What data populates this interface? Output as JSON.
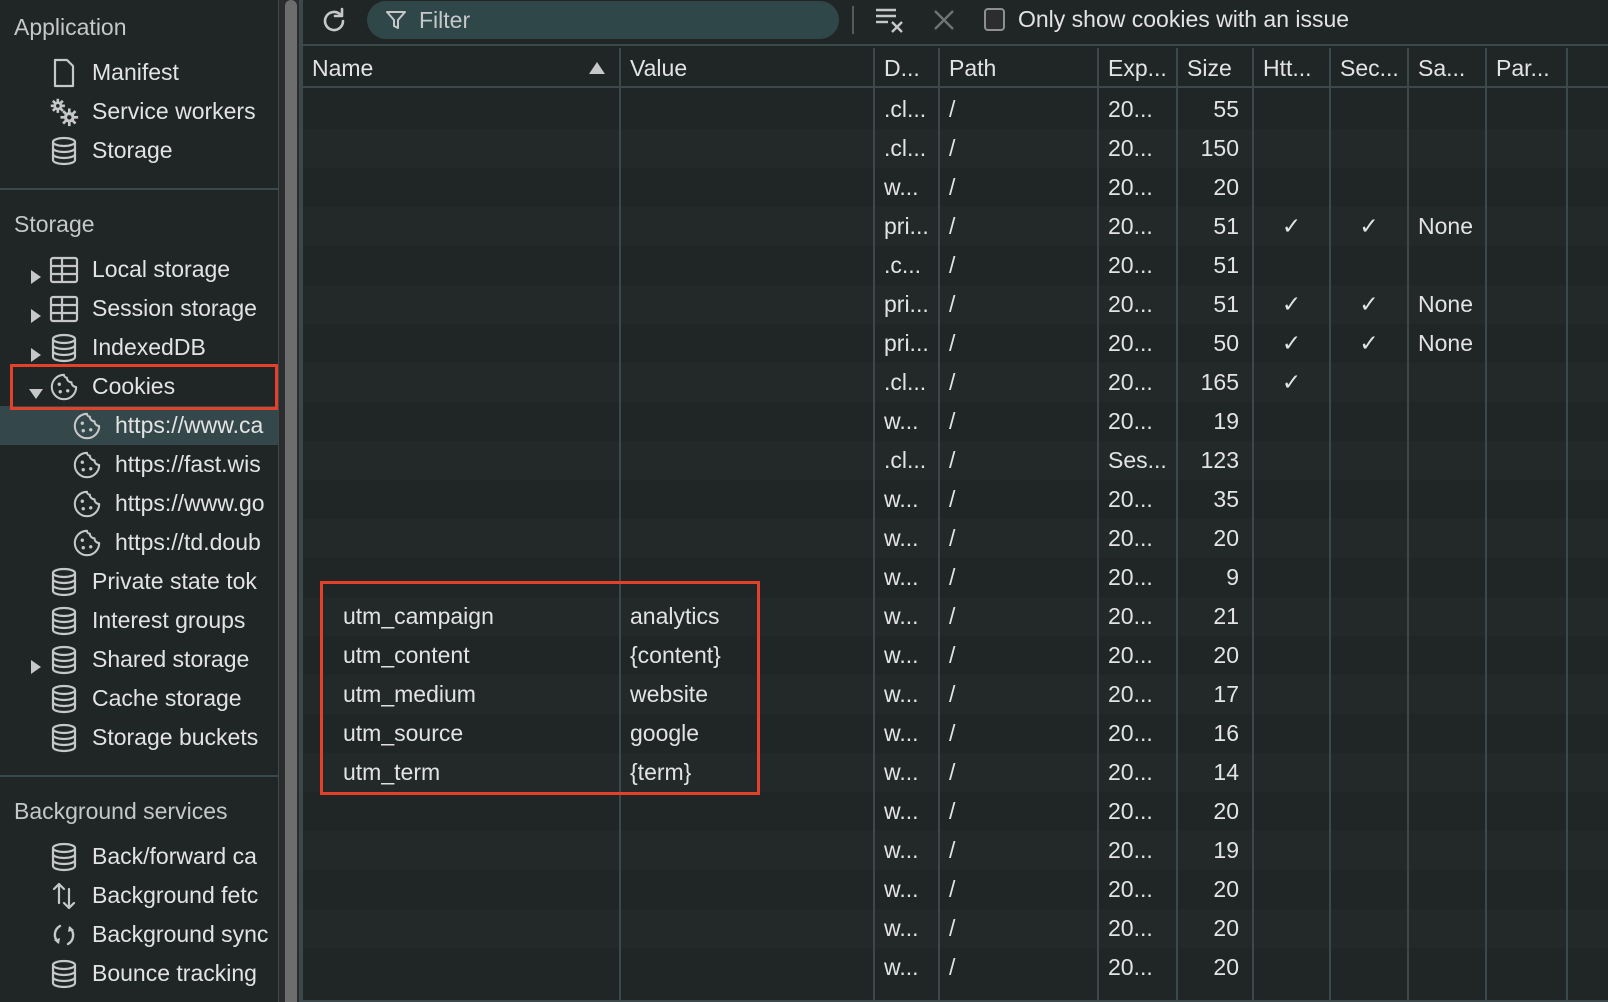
{
  "sidebar": {
    "application": {
      "title": "Application",
      "items": [
        {
          "label": "Manifest",
          "icon": "document-icon"
        },
        {
          "label": "Service workers",
          "icon": "gears-icon"
        },
        {
          "label": "Storage",
          "icon": "database-icon"
        }
      ]
    },
    "storage": {
      "title": "Storage",
      "items": [
        {
          "label": "Local storage",
          "icon": "table-icon",
          "expandable": true
        },
        {
          "label": "Session storage",
          "icon": "table-icon",
          "expandable": true
        },
        {
          "label": "IndexedDB",
          "icon": "database-icon",
          "expandable": true
        },
        {
          "label": "Cookies",
          "icon": "cookie-icon",
          "expanded": true
        },
        {
          "label": "Private state tok",
          "icon": "database-icon"
        },
        {
          "label": "Interest groups",
          "icon": "database-icon"
        },
        {
          "label": "Shared storage",
          "icon": "database-icon",
          "expandable": true
        },
        {
          "label": "Cache storage",
          "icon": "database-icon"
        },
        {
          "label": "Storage buckets",
          "icon": "database-icon"
        }
      ],
      "cookie_origins": [
        {
          "label": "https://www.ca",
          "selected": true
        },
        {
          "label": "https://fast.wis"
        },
        {
          "label": "https://www.go"
        },
        {
          "label": "https://td.doub"
        }
      ]
    },
    "background": {
      "title": "Background services",
      "items": [
        {
          "label": "Back/forward ca",
          "icon": "database-icon"
        },
        {
          "label": "Background fetc",
          "icon": "arrows-up-down-icon"
        },
        {
          "label": "Background sync",
          "icon": "sync-icon"
        },
        {
          "label": "Bounce tracking",
          "icon": "database-icon"
        }
      ]
    }
  },
  "toolbar": {
    "filter_placeholder": "Filter",
    "only_issues_label": "Only show cookies with an issue",
    "only_issues_checked": false
  },
  "table": {
    "columns": [
      "Name",
      "Value",
      "D...",
      "Path",
      "Exp...",
      "Size",
      "Htt...",
      "Sec...",
      "Sa...",
      "Par..."
    ],
    "sort": {
      "column": "Name",
      "direction": "ascending"
    },
    "rows": [
      {
        "name": "",
        "value": "",
        "domain": ".cl...",
        "path": "/",
        "expires": "20...",
        "size": "55",
        "httponly": "",
        "secure": "",
        "samesite": "",
        "partition": ""
      },
      {
        "name": "",
        "value": "",
        "domain": ".cl...",
        "path": "/",
        "expires": "20...",
        "size": "150",
        "httponly": "",
        "secure": "",
        "samesite": "",
        "partition": ""
      },
      {
        "name": "",
        "value": "",
        "domain": "w...",
        "path": "/",
        "expires": "20...",
        "size": "20",
        "httponly": "",
        "secure": "",
        "samesite": "",
        "partition": ""
      },
      {
        "name": "",
        "value": "",
        "domain": "pri...",
        "path": "/",
        "expires": "20...",
        "size": "51",
        "httponly": "✓",
        "secure": "✓",
        "samesite": "None",
        "partition": ""
      },
      {
        "name": "",
        "value": "",
        "domain": ".c...",
        "path": "/",
        "expires": "20...",
        "size": "51",
        "httponly": "",
        "secure": "",
        "samesite": "",
        "partition": ""
      },
      {
        "name": "",
        "value": "",
        "domain": "pri...",
        "path": "/",
        "expires": "20...",
        "size": "51",
        "httponly": "✓",
        "secure": "✓",
        "samesite": "None",
        "partition": ""
      },
      {
        "name": "",
        "value": "",
        "domain": "pri...",
        "path": "/",
        "expires": "20...",
        "size": "50",
        "httponly": "✓",
        "secure": "✓",
        "samesite": "None",
        "partition": ""
      },
      {
        "name": "",
        "value": "",
        "domain": ".cl...",
        "path": "/",
        "expires": "20...",
        "size": "165",
        "httponly": "✓",
        "secure": "",
        "samesite": "",
        "partition": ""
      },
      {
        "name": "",
        "value": "",
        "domain": "w...",
        "path": "/",
        "expires": "20...",
        "size": "19",
        "httponly": "",
        "secure": "",
        "samesite": "",
        "partition": ""
      },
      {
        "name": "",
        "value": "",
        "domain": ".cl...",
        "path": "/",
        "expires": "Ses...",
        "size": "123",
        "httponly": "",
        "secure": "",
        "samesite": "",
        "partition": ""
      },
      {
        "name": "",
        "value": "",
        "domain": "w...",
        "path": "/",
        "expires": "20...",
        "size": "35",
        "httponly": "",
        "secure": "",
        "samesite": "",
        "partition": ""
      },
      {
        "name": "",
        "value": "",
        "domain": "w...",
        "path": "/",
        "expires": "20...",
        "size": "20",
        "httponly": "",
        "secure": "",
        "samesite": "",
        "partition": ""
      },
      {
        "name": "",
        "value": "",
        "domain": "w...",
        "path": "/",
        "expires": "20...",
        "size": "9",
        "httponly": "",
        "secure": "",
        "samesite": "",
        "partition": ""
      },
      {
        "name": "utm_campaign",
        "value": "analytics",
        "domain": "w...",
        "path": "/",
        "expires": "20...",
        "size": "21",
        "httponly": "",
        "secure": "",
        "samesite": "",
        "partition": ""
      },
      {
        "name": "utm_content",
        "value": "{content}",
        "domain": "w...",
        "path": "/",
        "expires": "20...",
        "size": "20",
        "httponly": "",
        "secure": "",
        "samesite": "",
        "partition": ""
      },
      {
        "name": "utm_medium",
        "value": "website",
        "domain": "w...",
        "path": "/",
        "expires": "20...",
        "size": "17",
        "httponly": "",
        "secure": "",
        "samesite": "",
        "partition": ""
      },
      {
        "name": "utm_source",
        "value": "google",
        "domain": "w...",
        "path": "/",
        "expires": "20...",
        "size": "16",
        "httponly": "",
        "secure": "",
        "samesite": "",
        "partition": ""
      },
      {
        "name": "utm_term",
        "value": "{term}",
        "domain": "w...",
        "path": "/",
        "expires": "20...",
        "size": "14",
        "httponly": "",
        "secure": "",
        "samesite": "",
        "partition": ""
      },
      {
        "name": "",
        "value": "",
        "domain": "w...",
        "path": "/",
        "expires": "20...",
        "size": "20",
        "httponly": "",
        "secure": "",
        "samesite": "",
        "partition": ""
      },
      {
        "name": "",
        "value": "",
        "domain": "w...",
        "path": "/",
        "expires": "20...",
        "size": "19",
        "httponly": "",
        "secure": "",
        "samesite": "",
        "partition": ""
      },
      {
        "name": "",
        "value": "",
        "domain": "w...",
        "path": "/",
        "expires": "20...",
        "size": "20",
        "httponly": "",
        "secure": "",
        "samesite": "",
        "partition": ""
      },
      {
        "name": "",
        "value": "",
        "domain": "w...",
        "path": "/",
        "expires": "20...",
        "size": "20",
        "httponly": "",
        "secure": "",
        "samesite": "",
        "partition": ""
      },
      {
        "name": "",
        "value": "",
        "domain": "w...",
        "path": "/",
        "expires": "20...",
        "size": "20",
        "httponly": "",
        "secure": "",
        "samesite": "",
        "partition": ""
      }
    ]
  },
  "highlight_color": "#e4402a",
  "accent_colors": {
    "panel_bg": "#202526",
    "selected_bg": "#34474a",
    "filter_bg": "#2f4749",
    "grid_line": "#3b494c"
  }
}
